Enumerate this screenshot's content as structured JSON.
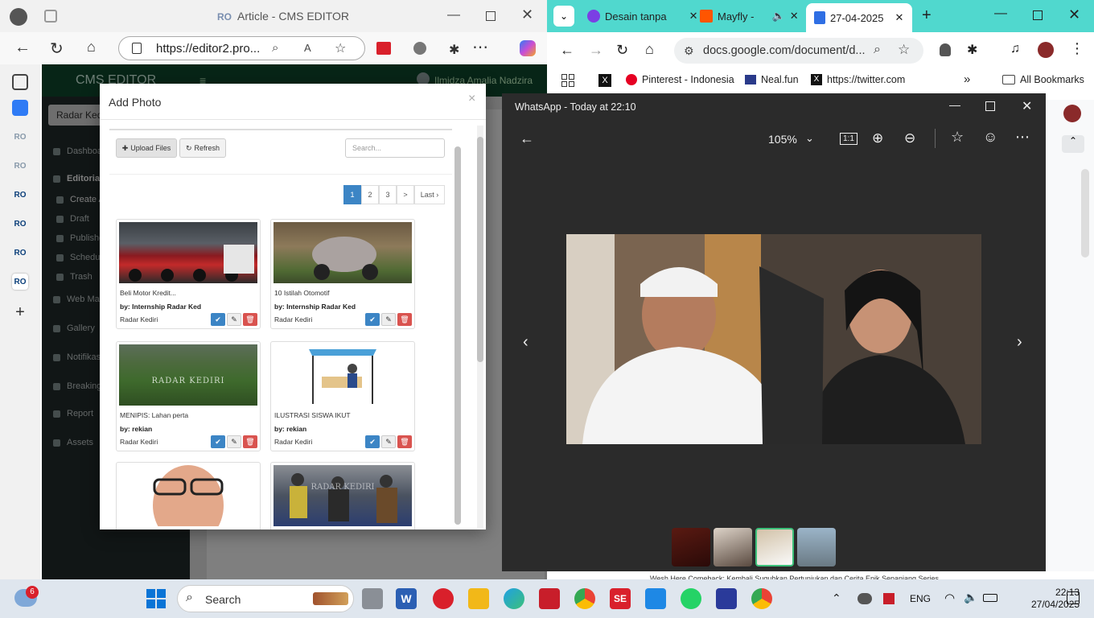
{
  "edge": {
    "tab_title": "Article - CMS EDITOR",
    "url": "https://editor2.pro...",
    "colors": {
      "accent": "#0f4a2e",
      "sidebar": "#222c2c"
    }
  },
  "cms": {
    "brand": "CMS EDITOR",
    "user": "Ilmidza Amalia Nadzira",
    "search_value": "Radar Kediri",
    "nav": [
      "Dashboard",
      "Editorial",
      "Create Article",
      "Draft",
      "Published",
      "Schedule",
      "Trash",
      "Web Management",
      "Gallery",
      "Notifikasi",
      "Breaking",
      "Report",
      "Assets"
    ]
  },
  "modal": {
    "title": "Add Photo",
    "close": "×",
    "upload_label": "Upload Files",
    "refresh_label": "Refresh",
    "search_placeholder": "Search...",
    "pages": [
      "1",
      "2",
      "3",
      ">",
      "Last ›"
    ],
    "cards": [
      {
        "caption": "Beli Motor Kredit...",
        "by": "by: Internship Radar Ked",
        "source": "Radar Kediri"
      },
      {
        "caption": "10 Istilah Otomotif",
        "by": "by: Internship Radar Ked",
        "source": "Radar Kediri"
      },
      {
        "caption": "MENIPIS: Lahan perta",
        "by": "by: rekian",
        "source": "Radar Kediri"
      },
      {
        "caption": "ILUSTRASI SISWA IKUT",
        "by": "by: rekian",
        "source": "Radar Kediri"
      }
    ],
    "watermark": "RADAR KEDIRI"
  },
  "chrome": {
    "tabs": [
      "Desain tanpa",
      "Mayfly -",
      "27-04-2025"
    ],
    "url": "docs.google.com/document/d...",
    "bookmarks": [
      "Pinterest - Indonesia",
      "Neal.fun",
      "https://twitter.com",
      "All Bookmarks"
    ],
    "doc_footer": "Wesh Here Comeback: Kembali Suguhkan Pertunjukan dan Cerita Epik Sepanjang Series"
  },
  "whatsapp": {
    "title": "WhatsApp - Today at 22:10",
    "zoom": "105%",
    "ratio": "1:1"
  },
  "taskbar": {
    "search": "Search",
    "weather_badge": "6",
    "lang": "ENG",
    "time": "22:13",
    "date": "27/04/2025"
  }
}
